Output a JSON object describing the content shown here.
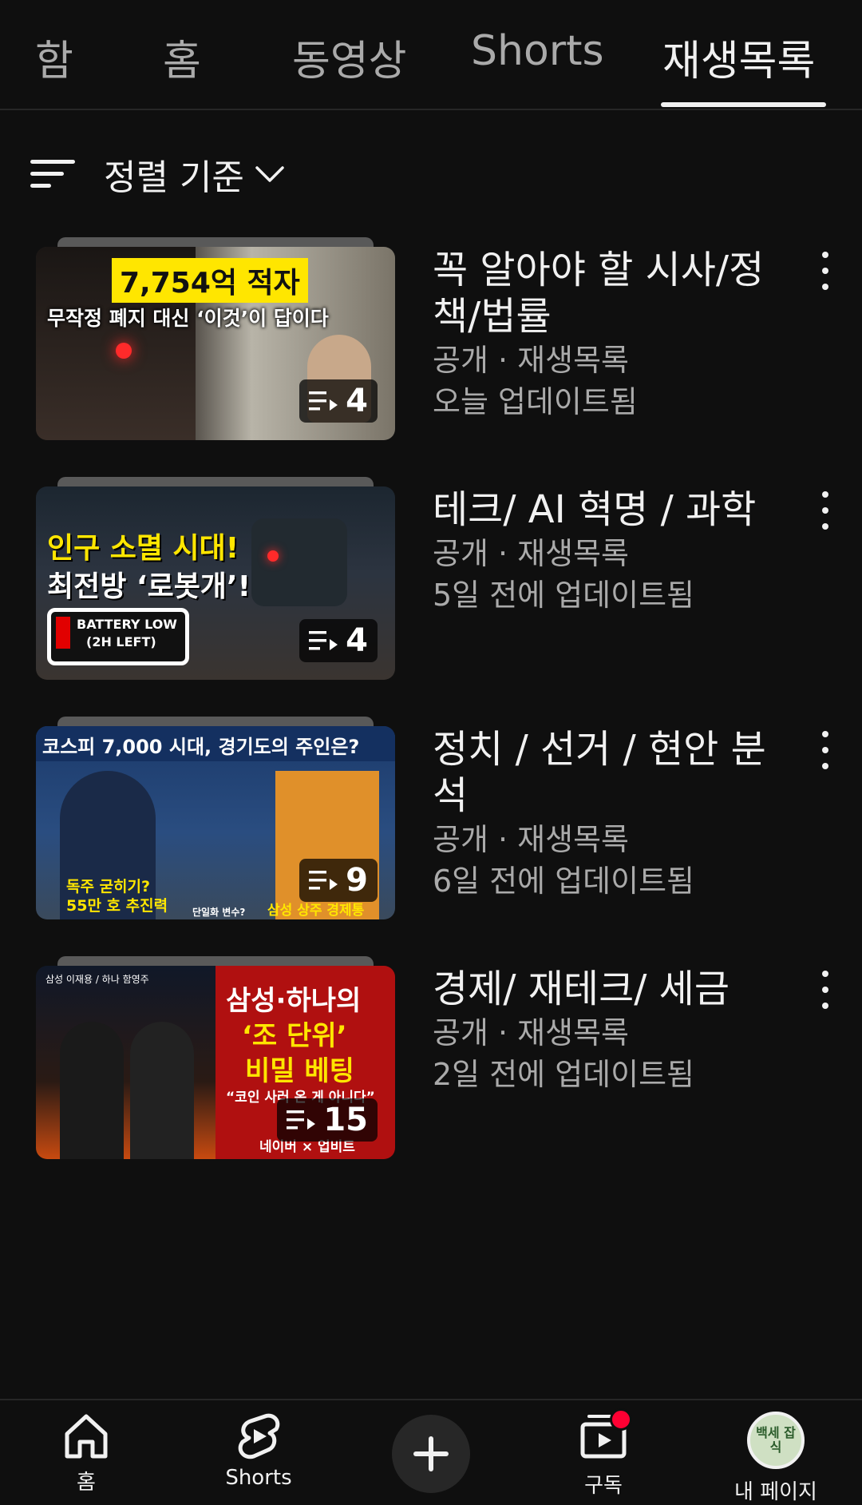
{
  "tabs": [
    {
      "label": "함"
    },
    {
      "label": "홈"
    },
    {
      "label": "동영상"
    },
    {
      "label": "Shorts"
    },
    {
      "label": "재생목록",
      "active": true
    }
  ],
  "sort": {
    "label": "정렬 기준"
  },
  "playlists": [
    {
      "title": "꼭 알아야 할 시사/정책/법률",
      "visibility": "공개 · 재생목록",
      "updated": "오늘 업데이트됨",
      "count": "4",
      "thumb_text": [
        "7,754억 적자",
        "무작정 폐지 대신 ‘이것’이 답이다"
      ]
    },
    {
      "title": "테크/ AI 혁명 / 과학",
      "visibility": "공개 · 재생목록",
      "updated": "5일 전에 업데이트됨",
      "count": "4",
      "thumb_text": [
        "인구 소멸 시대!",
        "최전방 ‘로봇개’!",
        "BATTERY LOW",
        "(2H LEFT)"
      ]
    },
    {
      "title": "정치 / 선거 / 현안 분석",
      "visibility": "공개 · 재생목록",
      "updated": "6일 전에 업데이트됨",
      "count": "9",
      "thumb_text": [
        "코스피 7,000 시대, 경기도의 주인은?",
        "독주 굳히기?",
        "55만 호 추진력",
        "단일화 변수?",
        "삼성 상주 경제통"
      ]
    },
    {
      "title": "경제/ 재테크/ 세금",
      "visibility": "공개 · 재생목록",
      "updated": "2일 전에 업데이트됨",
      "count": "15",
      "thumb_text": [
        "삼성 이재용 / 하나 함영주",
        "삼성·하나의",
        "‘조 단위’",
        "비밀 베팅",
        "“코인 사러 온 게 아니다”",
        "네이버 × 업비트"
      ]
    }
  ],
  "bottom_nav": [
    {
      "label": "홈",
      "icon": "home-icon"
    },
    {
      "label": "Shorts",
      "icon": "shorts-icon"
    },
    {
      "label": "",
      "icon": "create-icon"
    },
    {
      "label": "구독",
      "icon": "subscriptions-icon"
    },
    {
      "label": "내 페이지",
      "icon": "avatar",
      "avatar_text": "백세 잡식"
    }
  ],
  "colors": {
    "background": "#0f0f0f",
    "text": "#f1f1f1",
    "secondary": "#aaaaaa",
    "accent_red": "#ff0033"
  }
}
